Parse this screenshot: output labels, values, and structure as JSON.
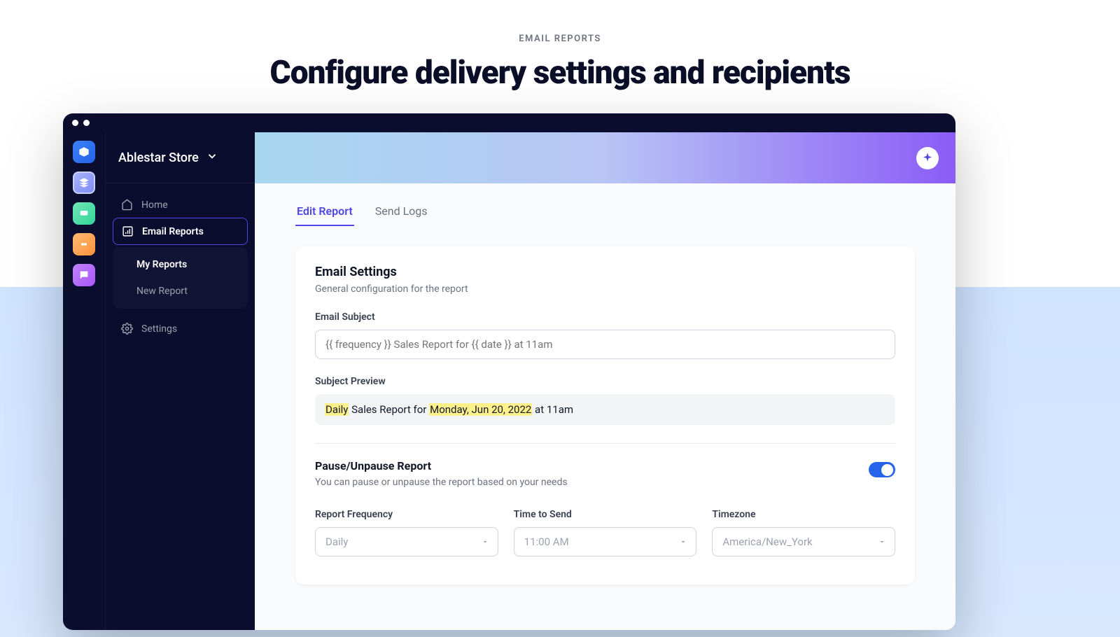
{
  "page": {
    "eyebrow": "EMAIL REPORTS",
    "title": "Configure delivery settings and recipients"
  },
  "store": {
    "name": "Ablestar Store"
  },
  "nav": {
    "home": "Home",
    "email_reports": "Email Reports",
    "my_reports": "My Reports",
    "new_report": "New Report",
    "settings": "Settings"
  },
  "tabs": {
    "edit": "Edit Report",
    "logs": "Send Logs"
  },
  "card": {
    "heading": "Email Settings",
    "subtitle": "General configuration for the report",
    "subject_label": "Email Subject",
    "subject_placeholder": "{{ frequency }} Sales Report for {{ date }} at 11am",
    "preview_label": "Subject Preview",
    "preview_hl1": "Daily",
    "preview_mid": " Sales Report for ",
    "preview_hl2": "Monday, Jun 20, 2022",
    "preview_tail": " at 11am",
    "pause_heading": "Pause/Unpause Report",
    "pause_text": "You can pause or unpause the report based on your needs",
    "freq_label": "Report Frequency",
    "freq_value": "Daily",
    "time_label": "Time to Send",
    "time_value": "11:00 AM",
    "tz_label": "Timezone",
    "tz_value": "America/New_York"
  }
}
